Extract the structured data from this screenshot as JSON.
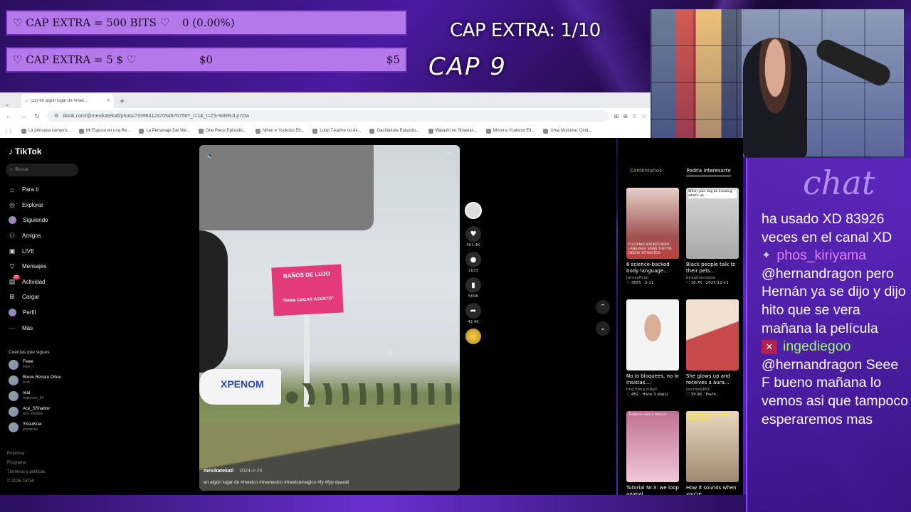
{
  "overlay": {
    "goal_bits_label": "♡ CAP EXTRA = 500 BITS ♡",
    "goal_bits_value": "0 (0.00%)",
    "goal_money_label": "♡ CAP EXTRA = 5 $ ♡",
    "goal_money_current": "$0",
    "goal_money_target": "$5",
    "cap_extra": "CAP EXTRA: 1/10",
    "cap_number": "CAP 9"
  },
  "browser": {
    "tab_title": "(22) en algún lugar de #mex...",
    "tab_close": "×",
    "new_tab": "+",
    "url": "tiktok.com/@mexikatekatl/photo/7339641247054876758?_r=1&_t=ZS-94RRJLp7Dw",
    "bookmarks": [
      "La princesa vampiro...",
      "Mi Esposo en una Re...",
      "La Personaje Del We...",
      "One Piece Episodio...",
      "Nihon e Youkoso Elf...",
      "Loop 7-kaime no Ak...",
      "Gachiakuta Episodio...",
      "Watashi no Shiawas...",
      "Nihon e Youkoso Elf...",
      "Uma Musume: Cind..."
    ]
  },
  "tiktok": {
    "logo": "TikTok",
    "search_placeholder": "Buscar",
    "nav": [
      {
        "label": "Para ti",
        "icon": "home-icon"
      },
      {
        "label": "Explorar",
        "icon": "compass-icon"
      },
      {
        "label": "Siguiendo",
        "icon": "following-icon"
      },
      {
        "label": "Amigos",
        "icon": "friends-icon"
      },
      {
        "label": "LIVE",
        "icon": "live-icon"
      },
      {
        "label": "Mensajes",
        "icon": "messages-icon"
      },
      {
        "label": "Actividad",
        "icon": "activity-icon",
        "badge": "22"
      },
      {
        "label": "Cargar",
        "icon": "upload-icon"
      },
      {
        "label": "Perfil",
        "icon": "profile-icon"
      },
      {
        "label": "Más",
        "icon": "more-icon"
      }
    ],
    "following_title": "Cuentas que sigues",
    "following": [
      {
        "name": "Fewe",
        "handle": "fewe_7"
      },
      {
        "name": "Bruno Renato Ortoe",
        "handle": "b.rst..."
      },
      {
        "name": "real",
        "handle": "realnarzo_64"
      },
      {
        "name": "Ace_SShadov",
        "handle": "ace_shadow"
      },
      {
        "name": "YissuKrax",
        "handle": "yissukrax"
      }
    ],
    "footer": [
      "Empresa",
      "Programa",
      "Términos y políticas",
      "© 2026 TikTok"
    ],
    "video": {
      "billboard_top": "BAÑOS DE LUJO",
      "billboard_bottom": "\"PARA CAGAR AGUSTO\"",
      "truck_text": "XPENOM",
      "username": "mexikatekatl",
      "date": "· 2024-2-25",
      "caption": "en algún lugar de #mexico #memexico #mexicomagico #fy #fyp #parati"
    },
    "actions": {
      "likes": "401.4K",
      "comments": "1633",
      "saves": "569K",
      "shares": "42.4K"
    },
    "panel_tabs": [
      "Comentarios",
      "Podría interesarte"
    ],
    "recommended": [
      {
        "title": "6 science-backed body language...",
        "author": "lizrosoffcial",
        "likes": "3555",
        "time": "2-11",
        "overlay": "6 SCIENCE-BACKED BODY LANGUAGE SIGNS THEY'RE DEEPLY ATTRACTED",
        "color": "#a05050"
      },
      {
        "title": "Black people talk to their pets...",
        "author": "biraubrandoise",
        "likes": "16.7K",
        "time": "2025-12-11",
        "overlay": "When your dog be knowing what's up",
        "color": "#a8a8a8"
      },
      {
        "title": "No lo bloquees, no lo insistas....",
        "author": "hng.hong.sukyh",
        "likes": "482",
        "time": "Hace 3 día(s)",
        "overlay": "",
        "color": "#e0e0e8"
      },
      {
        "title": "She glows up and receives a aura...",
        "author": "ilocrite6969",
        "likes": "39.9K",
        "time": "Hace...",
        "overlay": "",
        "color": "#c84a4a"
      },
      {
        "title": "Tutorial Nr.3: we loop animal",
        "author": "",
        "likes": "",
        "time": "",
        "overlay": "Tonterías dance tutorial",
        "color": "#b86080"
      },
      {
        "title": "How it sounds when you're...",
        "author": "",
        "likes": "",
        "time": "",
        "overlay": "I Found You! Ahh Ha Ha Ha!",
        "color": "#c0a890"
      }
    ]
  },
  "chat": {
    "title": "chat",
    "line0": "ha usado XD 83926 veces en el canal XD",
    "msg1_user": "phos_kiriyama",
    "msg1_text": "@hernandragon pero Hernán ya se dijo y dijo hito que se vera mañana la película",
    "msg2_user": "ingediegoo",
    "msg2_text": "@hernandragon Seee F bueno mañana lo vemos asi que tampoco esperaremos mas"
  },
  "colors": {
    "goal_bar": "#b478ea",
    "chat_bg": "#5f28be",
    "accent_pink": "#fe2c55"
  }
}
